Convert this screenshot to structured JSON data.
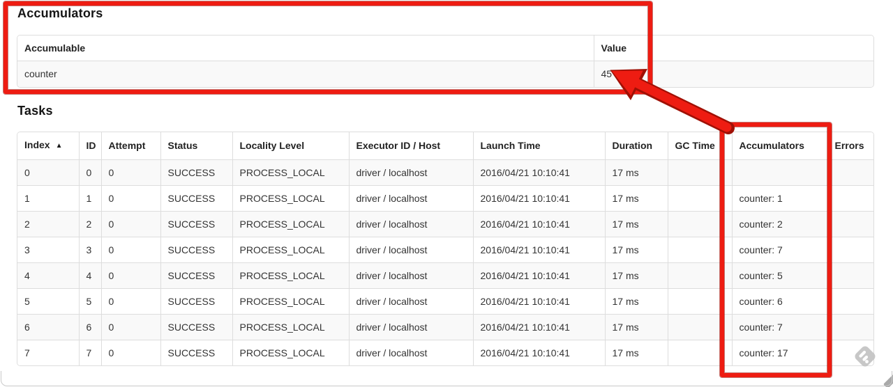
{
  "accumulators_section": {
    "title": "Accumulators",
    "table": {
      "headers": {
        "accumulable": "Accumulable",
        "value": "Value"
      },
      "row": {
        "accumulable": "counter",
        "value": "45"
      }
    }
  },
  "tasks_section": {
    "title": "Tasks",
    "table": {
      "headers": [
        "Index",
        "ID",
        "Attempt",
        "Status",
        "Locality Level",
        "Executor ID / Host",
        "Launch Time",
        "Duration",
        "GC Time",
        "Accumulators",
        "Errors"
      ],
      "sort_indicator": "▲",
      "rows": [
        [
          "0",
          "0",
          "0",
          "SUCCESS",
          "PROCESS_LOCAL",
          "driver / localhost",
          "2016/04/21 10:10:41",
          "17 ms",
          "",
          "",
          ""
        ],
        [
          "1",
          "1",
          "0",
          "SUCCESS",
          "PROCESS_LOCAL",
          "driver / localhost",
          "2016/04/21 10:10:41",
          "17 ms",
          "",
          "counter: 1",
          ""
        ],
        [
          "2",
          "2",
          "0",
          "SUCCESS",
          "PROCESS_LOCAL",
          "driver / localhost",
          "2016/04/21 10:10:41",
          "17 ms",
          "",
          "counter: 2",
          ""
        ],
        [
          "3",
          "3",
          "0",
          "SUCCESS",
          "PROCESS_LOCAL",
          "driver / localhost",
          "2016/04/21 10:10:41",
          "17 ms",
          "",
          "counter: 7",
          ""
        ],
        [
          "4",
          "4",
          "0",
          "SUCCESS",
          "PROCESS_LOCAL",
          "driver / localhost",
          "2016/04/21 10:10:41",
          "17 ms",
          "",
          "counter: 5",
          ""
        ],
        [
          "5",
          "5",
          "0",
          "SUCCESS",
          "PROCESS_LOCAL",
          "driver / localhost",
          "2016/04/21 10:10:41",
          "17 ms",
          "",
          "counter: 6",
          ""
        ],
        [
          "6",
          "6",
          "0",
          "SUCCESS",
          "PROCESS_LOCAL",
          "driver / localhost",
          "2016/04/21 10:10:41",
          "17 ms",
          "",
          "counter: 7",
          ""
        ],
        [
          "7",
          "7",
          "0",
          "SUCCESS",
          "PROCESS_LOCAL",
          "driver / localhost",
          "2016/04/21 10:10:41",
          "17 ms",
          "",
          "counter: 17",
          ""
        ]
      ]
    }
  },
  "annotations": {
    "highlight_color": "#ee1c12",
    "highlight_edge_color": "#940a02",
    "boxes": [
      "accumulators-section",
      "accumulators-column"
    ],
    "arrow_target": "45"
  },
  "icons": {
    "feedly_share": "feedly-share-icon",
    "feedly_color": "#c7c7c7"
  },
  "table_style": {
    "stripe_color": "#f9f9f9",
    "border_color": "#dddddd"
  }
}
